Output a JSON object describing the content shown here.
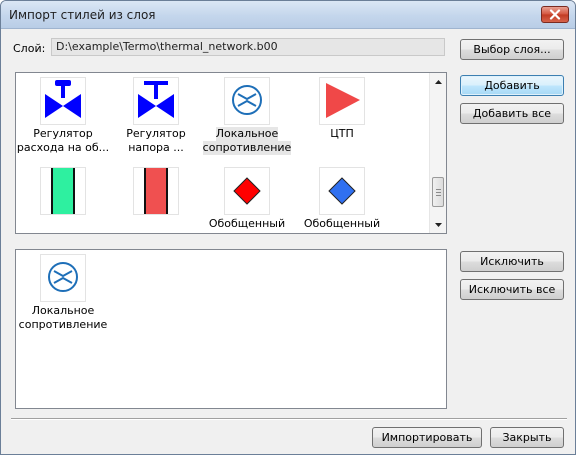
{
  "window": {
    "title": "Импорт стилей из слоя"
  },
  "layer": {
    "label": "Слой:",
    "path": "D:\\example\\Termo\\thermal_network.b00"
  },
  "buttons": {
    "choose_layer": "Выбор слоя...",
    "add": "Добавить",
    "add_all": "Добавить все",
    "exclude": "Исключить",
    "exclude_all": "Исключить все",
    "import": "Импортировать",
    "close": "Закрыть"
  },
  "available_styles": [
    {
      "label_lines": [
        "Регулятор",
        "расхода на об..."
      ],
      "icon": "flow-regulator-valve-icon"
    },
    {
      "label_lines": [
        "Регулятор",
        "напора ..."
      ],
      "icon": "pressure-regulator-valve-icon"
    },
    {
      "label_lines": [
        "Локальное",
        "сопротивление"
      ],
      "icon": "local-resistance-icon",
      "selected": true
    },
    {
      "label_lines": [
        "ЦТП"
      ],
      "icon": "ctp-triangle-icon"
    },
    {
      "label_lines": [
        ""
      ],
      "icon": "green-pipe-icon"
    },
    {
      "label_lines": [
        ""
      ],
      "icon": "red-pipe-icon"
    },
    {
      "label_lines": [
        "Обобщенный"
      ],
      "icon": "red-diamond-icon"
    },
    {
      "label_lines": [
        "Обобщенный"
      ],
      "icon": "blue-diamond-icon"
    }
  ],
  "selected_styles": [
    {
      "label_lines": [
        "Локальное",
        "сопротивление"
      ],
      "icon": "local-resistance-icon"
    }
  ],
  "colors": {
    "valve_blue": "#0000ff",
    "resistance_blue": "#1e6fb8",
    "ctp_red": "#f04848",
    "pipe_green": "#2ef0a0",
    "pipe_red": "#f05050",
    "diamond_red": "#ff0000",
    "diamond_blue": "#3070f0"
  }
}
